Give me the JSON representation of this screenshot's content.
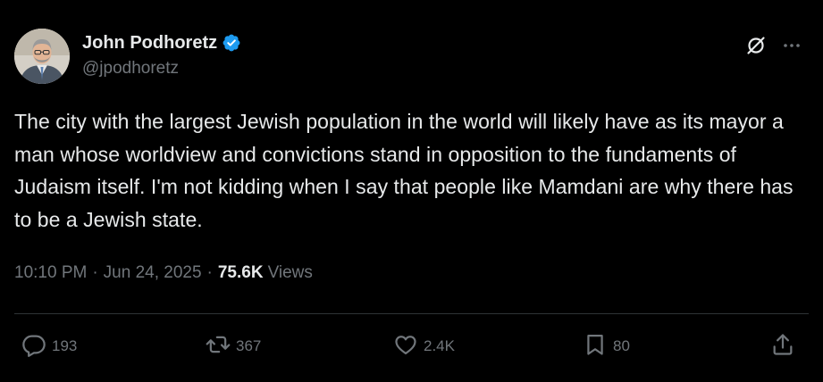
{
  "author": {
    "display_name": "John Podhoretz",
    "handle": "@jpodhoretz",
    "verified": true
  },
  "tweet": {
    "text": "The city with the largest Jewish population in the world will likely have as its mayor a man whose worldview and convictions stand in opposition to the fundaments of Judaism itself. I'm not kidding when I say that people like Mamdani are why there has to be a Jewish state.",
    "time": "10:10 PM",
    "separator": "·",
    "date": "Jun 24, 2025",
    "views_count": "75.6K",
    "views_label": "Views"
  },
  "actions": {
    "replies": "193",
    "reposts": "367",
    "likes": "2.4K",
    "bookmarks": "80"
  },
  "icons": {
    "verified": "verified-badge-icon",
    "grok": "grok-icon",
    "more": "more-icon",
    "reply": "reply-icon",
    "repost": "repost-icon",
    "like": "heart-icon",
    "bookmark": "bookmark-icon",
    "share": "share-icon"
  },
  "colors": {
    "background": "#000000",
    "text_primary": "#e7e9ea",
    "text_secondary": "#71767b",
    "verified_blue": "#1d9bf0",
    "divider": "#2f3336"
  }
}
